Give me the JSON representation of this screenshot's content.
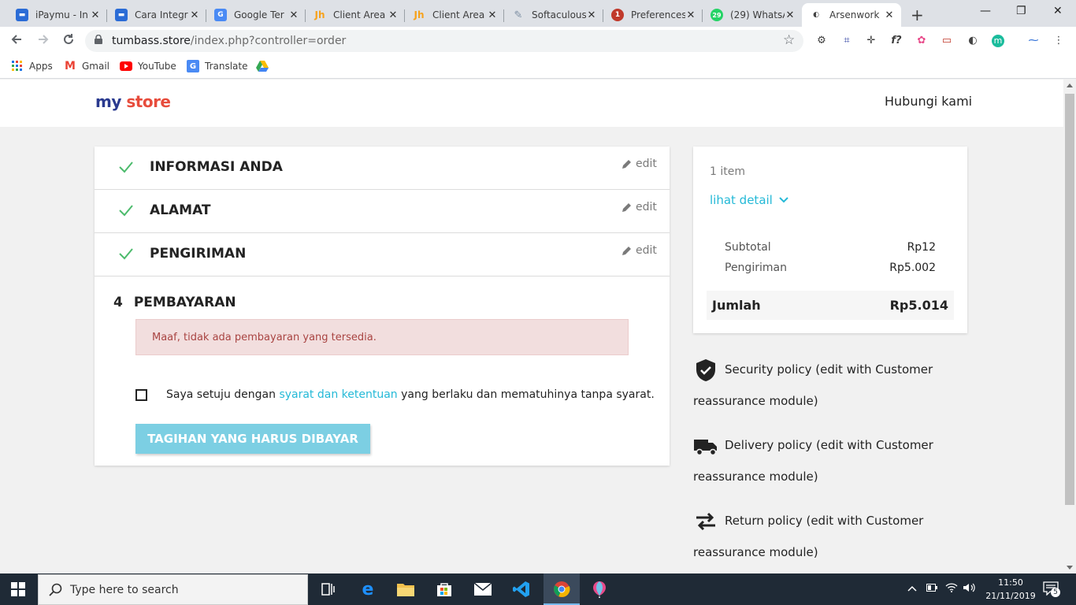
{
  "browser": {
    "tabs": [
      {
        "title": "iPaymu - In",
        "color": "#2b6cd6",
        "glyph": "▬"
      },
      {
        "title": "Cara Integr",
        "color": "#2b6cd6",
        "glyph": "▬"
      },
      {
        "title": "Google Ter",
        "color": "#4a8af4",
        "glyph": "G"
      },
      {
        "title": "Client Area",
        "color": "#f7a21b",
        "glyph": "Jh"
      },
      {
        "title": "Client Area",
        "color": "#f7a21b",
        "glyph": "Jh"
      },
      {
        "title": "Softaculous",
        "color": "#7d8fa3",
        "glyph": "✎"
      },
      {
        "title": "Preferences",
        "color": "#c0392b",
        "glyph": "1"
      },
      {
        "title": "(29) WhatsA",
        "color": "#25d366",
        "glyph": "29"
      },
      {
        "title": "Arsenwork",
        "color": "#444444",
        "glyph": "◐"
      }
    ],
    "new_tab": "+",
    "controls": {
      "minimize": "—",
      "maximize": "❐",
      "close": "✕"
    },
    "url_host": "tumbass.store",
    "url_path": "/index.php?controller=order",
    "bookmarks": [
      {
        "label": "Apps",
        "icon": "apps-grid-icon"
      },
      {
        "label": "Gmail",
        "icon": "gmail-icon"
      },
      {
        "label": "YouTube",
        "icon": "youtube-icon"
      },
      {
        "label": "Translate",
        "icon": "translate-icon"
      },
      {
        "label": "",
        "icon": "drive-icon"
      }
    ],
    "ext_f": "f?",
    "ext_m": "m"
  },
  "site": {
    "logo_my": "my",
    "logo_store": "store",
    "contact": "Hubungi kami"
  },
  "checkout": {
    "steps": [
      {
        "title": "INFORMASI ANDA",
        "edit": "edit"
      },
      {
        "title": "ALAMAT",
        "edit": "edit"
      },
      {
        "title": "PENGIRIMAN",
        "edit": "edit"
      }
    ],
    "payment": {
      "number": "4",
      "title": "PEMBAYARAN",
      "alert": "Maaf, tidak ada pembayaran yang tersedia.",
      "terms_before": "Saya setuju dengan ",
      "terms_link": "syarat dan ketentuan",
      "terms_after": " yang berlaku dan mematuhinya tanpa syarat.",
      "button": "TAGIHAN YANG HARUS DIBAYAR"
    }
  },
  "summary": {
    "items": "1 item",
    "detail_link": "lihat detail",
    "subtotal_label": "Subtotal",
    "subtotal_value": "Rp12",
    "shipping_label": "Pengiriman",
    "shipping_value": "Rp5.002",
    "total_label": "Jumlah",
    "total_value": "Rp5.014"
  },
  "reassurance": [
    {
      "text": "Security policy (edit with Customer reassurance module)"
    },
    {
      "text": "Delivery policy (edit with Customer reassurance module)"
    },
    {
      "text": "Return policy (edit with Customer reassurance module)"
    }
  ],
  "taskbar": {
    "search_placeholder": "Type here to search",
    "time": "11:50",
    "date": "21/11/2019",
    "notifications": "5"
  },
  "colors": {
    "accent": "#24b9d7",
    "check": "#4cbb6c",
    "alert_bg": "#f2dede",
    "alert_text": "#a94442",
    "button": "#7ccfe3"
  }
}
